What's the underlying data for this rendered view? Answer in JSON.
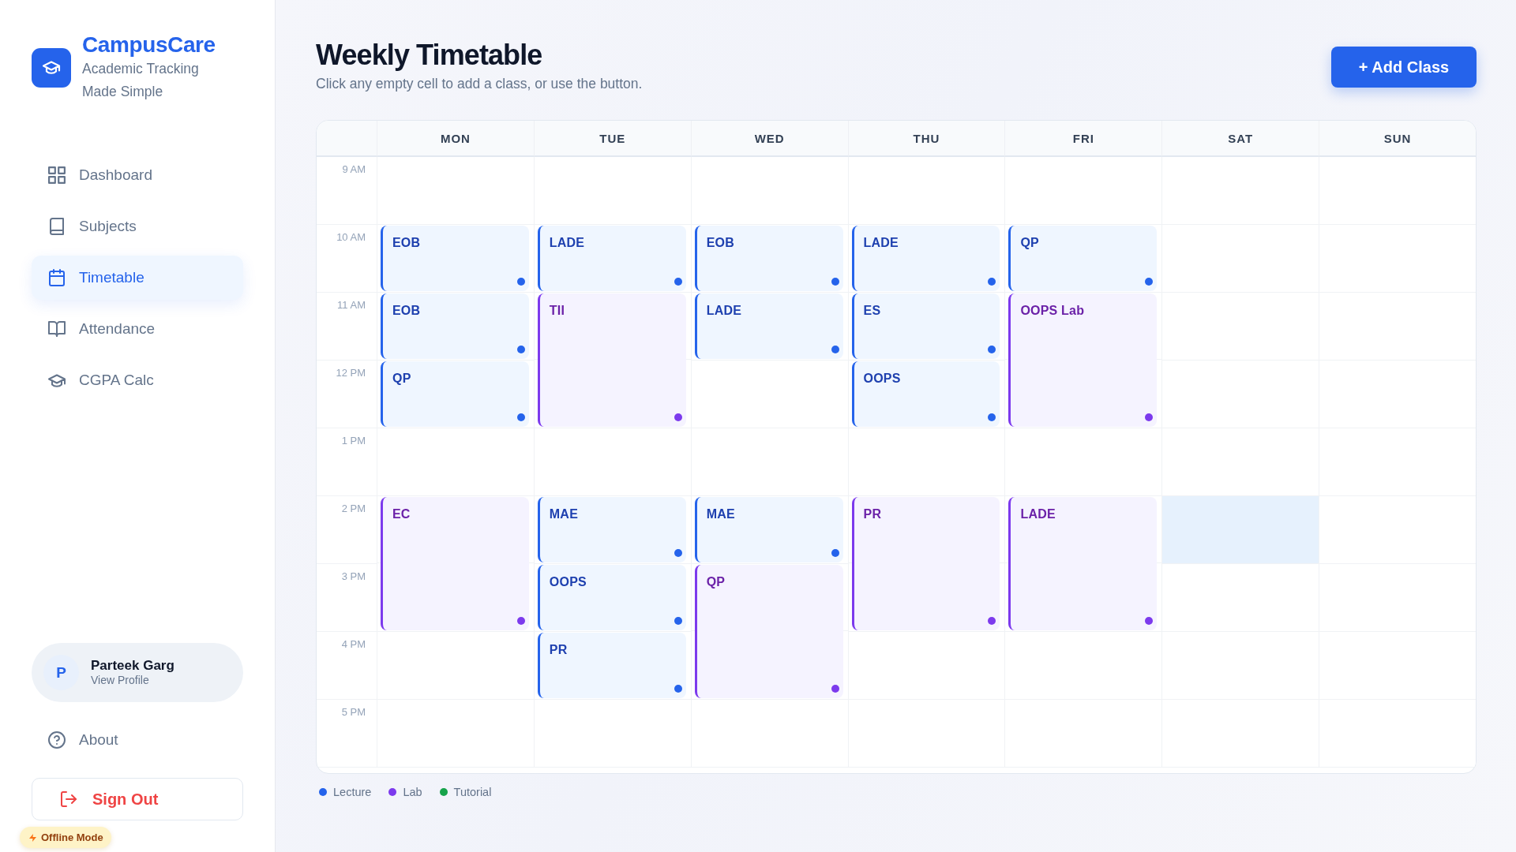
{
  "sidebar": {
    "brand": {
      "name": "CampusCare",
      "tagline": "Academic Tracking Made Simple"
    },
    "nav": [
      {
        "label": "Dashboard",
        "selected": false
      },
      {
        "label": "Subjects",
        "selected": false
      },
      {
        "label": "Timetable",
        "selected": true
      },
      {
        "label": "Attendance",
        "selected": false
      },
      {
        "label": "CGPA Calc",
        "selected": false
      }
    ],
    "profile": {
      "initial": "P",
      "name": "Parteek Garg",
      "link": "View Profile"
    },
    "about": "About",
    "sign_out": "Sign Out",
    "offline_badge": "Offline Mode"
  },
  "header": {
    "title": "Weekly Timetable",
    "subtitle": "Click any empty cell to add a class, or use the button.",
    "add_button": "+ Add Class"
  },
  "timetable": {
    "times": [
      "9 AM",
      "10 AM",
      "11 AM",
      "12 PM",
      "1 PM",
      "2 PM",
      "3 PM",
      "4 PM",
      "5 PM"
    ],
    "days": [
      {
        "label": "MON",
        "slots": [
          {
            "kind": "empty",
            "highlighted": false
          },
          {
            "kind": "lecture",
            "subject": "EOB",
            "double": false
          },
          {
            "kind": "lecture",
            "subject": "EOB",
            "double": false
          },
          {
            "kind": "lecture",
            "subject": "QP",
            "double": false
          },
          {
            "kind": "empty",
            "highlighted": false
          },
          {
            "kind": "lab",
            "subject": "EC",
            "double": true
          },
          {
            "kind": "empty",
            "highlighted": false
          },
          {
            "kind": "empty",
            "highlighted": false
          }
        ]
      },
      {
        "label": "TUE",
        "slots": [
          {
            "kind": "empty",
            "highlighted": false
          },
          {
            "kind": "lecture",
            "subject": "LADE",
            "double": false
          },
          {
            "kind": "lab",
            "subject": "TII",
            "double": true
          },
          {
            "kind": "empty",
            "highlighted": false
          },
          {
            "kind": "lecture",
            "subject": "MAE",
            "double": false
          },
          {
            "kind": "lecture",
            "subject": "OOPS",
            "double": false
          },
          {
            "kind": "lecture",
            "subject": "PR",
            "double": false
          },
          {
            "kind": "empty",
            "highlighted": false
          }
        ]
      },
      {
        "label": "WED",
        "slots": [
          {
            "kind": "empty",
            "highlighted": false
          },
          {
            "kind": "lecture",
            "subject": "EOB",
            "double": false
          },
          {
            "kind": "lecture",
            "subject": "LADE",
            "double": false
          },
          {
            "kind": "empty",
            "highlighted": false
          },
          {
            "kind": "empty",
            "highlighted": false
          },
          {
            "kind": "lecture",
            "subject": "MAE",
            "double": false
          },
          {
            "kind": "lab",
            "subject": "QP",
            "double": true
          },
          {
            "kind": "empty",
            "highlighted": false
          }
        ]
      },
      {
        "label": "THU",
        "slots": [
          {
            "kind": "empty",
            "highlighted": false
          },
          {
            "kind": "lecture",
            "subject": "LADE",
            "double": false
          },
          {
            "kind": "lecture",
            "subject": "ES",
            "double": false
          },
          {
            "kind": "lecture",
            "subject": "OOPS",
            "double": false
          },
          {
            "kind": "empty",
            "highlighted": false
          },
          {
            "kind": "lab",
            "subject": "PR",
            "double": true
          },
          {
            "kind": "empty",
            "highlighted": false
          },
          {
            "kind": "empty",
            "highlighted": false
          }
        ]
      },
      {
        "label": "FRI",
        "slots": [
          {
            "kind": "empty",
            "highlighted": false
          },
          {
            "kind": "lecture",
            "subject": "QP",
            "double": false
          },
          {
            "kind": "lab",
            "subject": "OOPS Lab",
            "double": true
          },
          {
            "kind": "empty",
            "highlighted": false
          },
          {
            "kind": "lab",
            "subject": "LADE",
            "double": true
          },
          {
            "kind": "empty",
            "highlighted": false
          },
          {
            "kind": "empty",
            "highlighted": false
          }
        ]
      },
      {
        "label": "SAT",
        "slots": [
          {
            "kind": "empty",
            "highlighted": false
          },
          {
            "kind": "empty",
            "highlighted": false
          },
          {
            "kind": "empty",
            "highlighted": false
          },
          {
            "kind": "empty",
            "highlighted": false
          },
          {
            "kind": "empty",
            "highlighted": false
          },
          {
            "kind": "empty",
            "highlighted": true
          },
          {
            "kind": "empty",
            "highlighted": false
          },
          {
            "kind": "empty",
            "highlighted": false
          },
          {
            "kind": "empty",
            "highlighted": false
          }
        ]
      },
      {
        "label": "SUN",
        "slots": [
          {
            "kind": "empty",
            "highlighted": false
          },
          {
            "kind": "empty",
            "highlighted": false
          },
          {
            "kind": "empty",
            "highlighted": false
          },
          {
            "kind": "empty",
            "highlighted": false
          },
          {
            "kind": "empty",
            "highlighted": false
          },
          {
            "kind": "empty",
            "highlighted": false
          },
          {
            "kind": "empty",
            "highlighted": false
          },
          {
            "kind": "empty",
            "highlighted": false
          },
          {
            "kind": "empty",
            "highlighted": false
          }
        ]
      }
    ]
  },
  "legend": [
    {
      "label": "Lecture",
      "color": "#2563eb"
    },
    {
      "label": "Lab",
      "color": "#7c3aed"
    },
    {
      "label": "Tutorial",
      "color": "#16a34a"
    }
  ]
}
